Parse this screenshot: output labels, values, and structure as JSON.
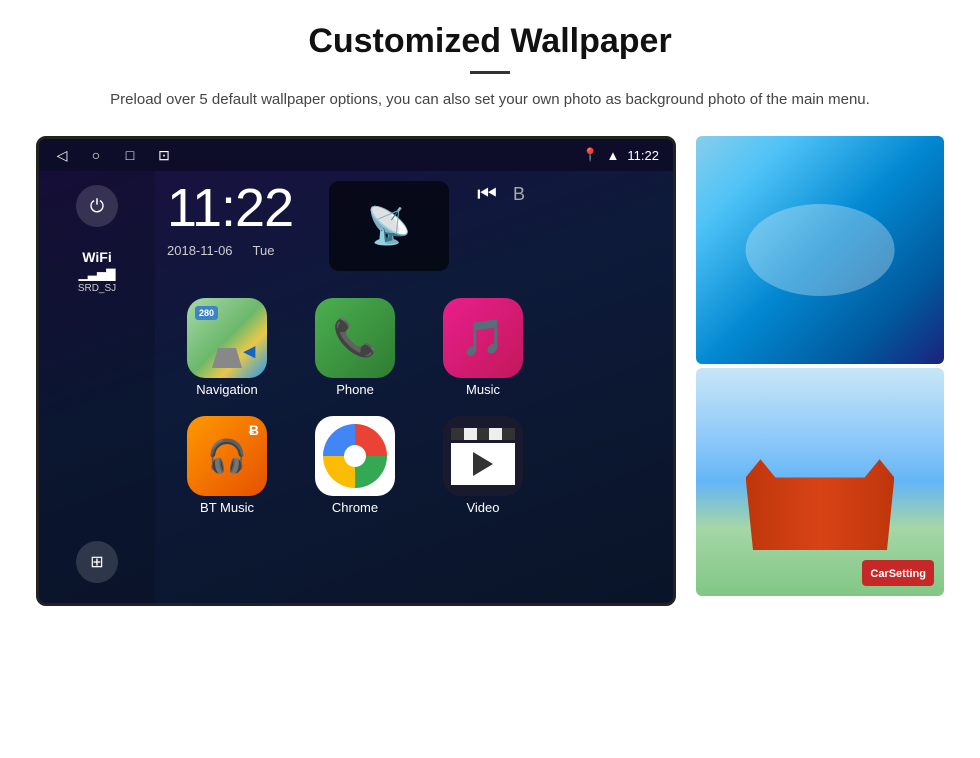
{
  "header": {
    "title": "Customized Wallpaper",
    "description": "Preload over 5 default wallpaper options, you can also set your own photo as background photo of the main menu."
  },
  "device": {
    "status_bar": {
      "time": "11:22",
      "wifi_icon": "▲",
      "nav_icon": "◁",
      "home_icon": "○",
      "recent_icon": "□",
      "screenshot_icon": "⊡",
      "location_icon": "📍"
    },
    "clock": {
      "time": "11:22",
      "date": "2018-11-06",
      "day": "Tue"
    },
    "sidebar": {
      "power_label": "⏻",
      "wifi_label": "WiFi",
      "wifi_bars": "▁▃▅▇",
      "network_name": "SRD_SJ",
      "apps_icon": "⊞"
    },
    "apps": [
      {
        "name": "Navigation",
        "type": "navigation"
      },
      {
        "name": "Phone",
        "type": "phone"
      },
      {
        "name": "Music",
        "type": "music"
      },
      {
        "name": "BT Music",
        "type": "bt"
      },
      {
        "name": "Chrome",
        "type": "chrome"
      },
      {
        "name": "Video",
        "type": "video"
      }
    ]
  },
  "wallpapers": {
    "thumb1_alt": "Ice cave wallpaper",
    "thumb2_alt": "Golden Gate bridge wallpaper",
    "carsetting_label": "CarSetting"
  }
}
